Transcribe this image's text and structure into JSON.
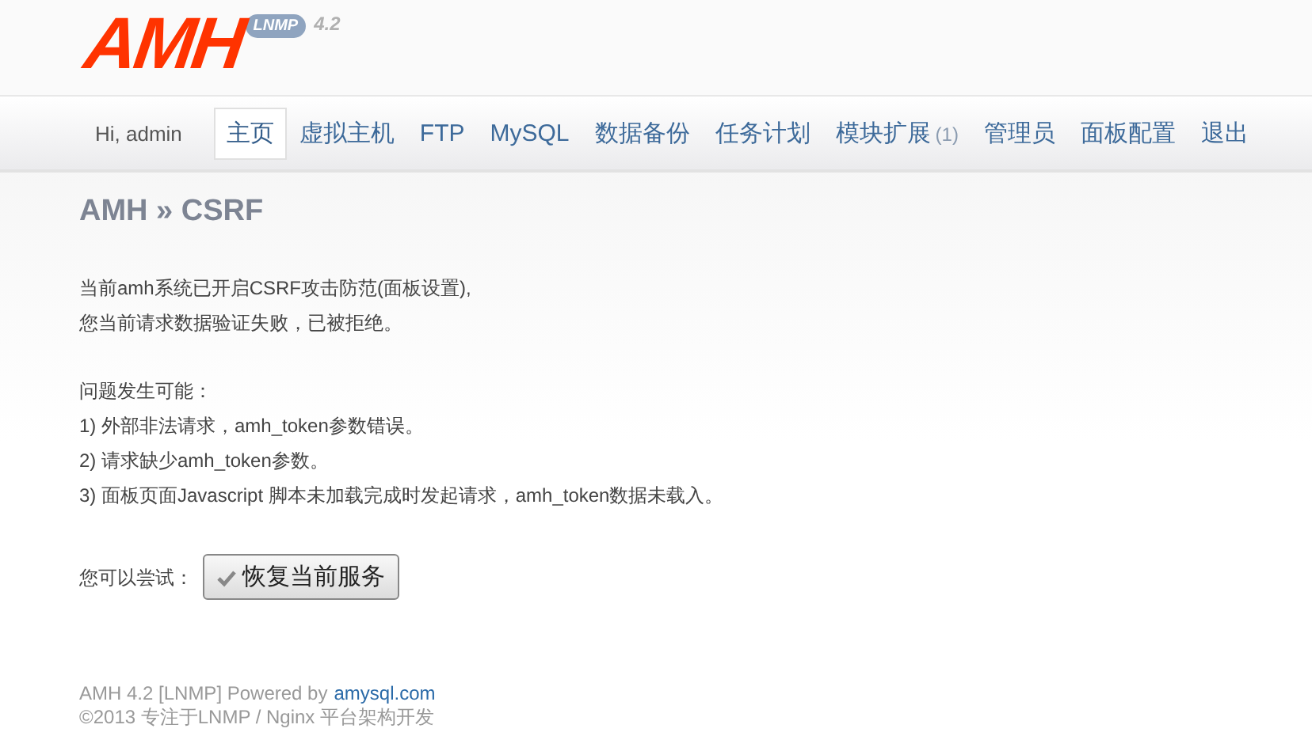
{
  "logo": {
    "text": "AMH",
    "badge": "LNMP",
    "version": "4.2"
  },
  "nav": {
    "greeting": "Hi, admin",
    "items": [
      {
        "label": "主页",
        "selected": true
      },
      {
        "label": "虚拟主机",
        "selected": false
      },
      {
        "label": "FTP",
        "selected": false
      },
      {
        "label": "MySQL",
        "selected": false
      },
      {
        "label": "数据备份",
        "selected": false
      },
      {
        "label": "任务计划",
        "selected": false
      },
      {
        "label": "模块扩展",
        "count": "(1)",
        "selected": false
      },
      {
        "label": "管理员",
        "selected": false
      },
      {
        "label": "面板配置",
        "selected": false
      },
      {
        "label": "退出",
        "selected": false
      }
    ]
  },
  "page_title": "AMH » CSRF",
  "paragraphs": [
    [
      "当前amh系统已开启CSRF攻击防范(面板设置),",
      "您当前请求数据验证失败，已被拒绝。"
    ],
    [
      "问题发生可能：",
      "1) 外部非法请求，amh_token参数错误。",
      "2) 请求缺少amh_token参数。",
      "3) 面板页面Javascript 脚本未加载完成时发起请求，amh_token数据未载入。"
    ]
  ],
  "try": {
    "label": "您可以尝试：",
    "button": "恢复当前服务"
  },
  "footer": {
    "line_1": "AMH 4.2 [LNMP] Powered by",
    "link": "amysql.com",
    "line_2": "©2013 专注于LNMP / Nginx 平台架构开发"
  }
}
